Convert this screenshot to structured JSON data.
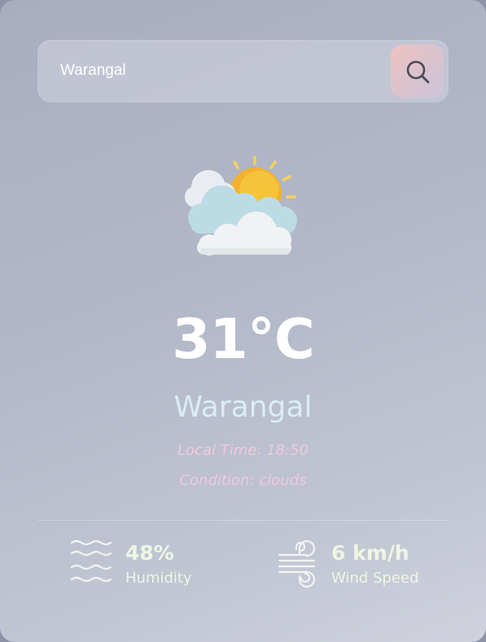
{
  "search": {
    "value": "Warangal",
    "button_icon": "search-icon"
  },
  "weather": {
    "icon": "partly-cloudy-sun-icon",
    "temperature": "31°C",
    "city": "Warangal",
    "local_time": "Local Time: 18:50",
    "condition": "Condition: clouds"
  },
  "stats": {
    "humidity": {
      "icon": "humidity-waves-icon",
      "value": "48%",
      "label": "Humidity"
    },
    "wind": {
      "icon": "wind-icon",
      "value": "6 km/h",
      "label": "Wind Speed"
    }
  },
  "colors": {
    "city_text": "#d8eef4",
    "meta_text": "#eec9dc",
    "stat_text": "#eef6e4",
    "search_button_accent": "#eec3c0"
  }
}
